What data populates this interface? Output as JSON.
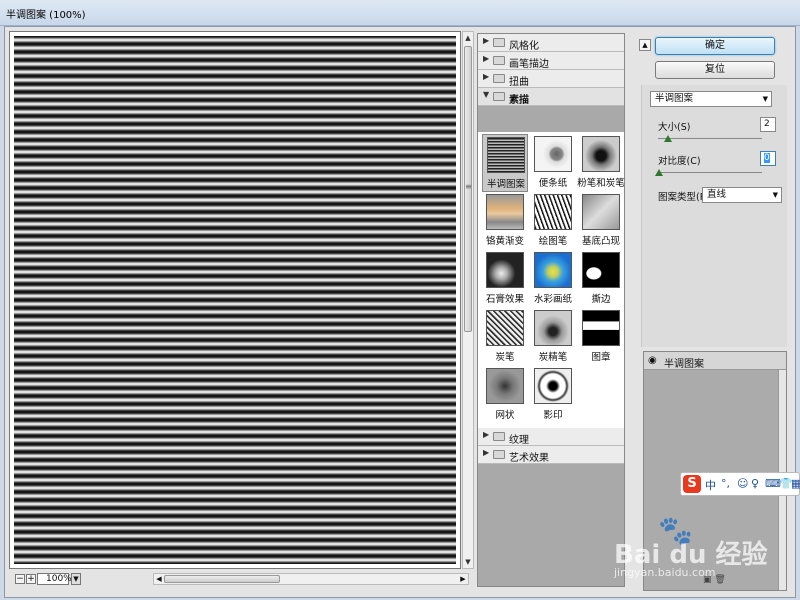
{
  "window": {
    "title": "半调图案 (100%)"
  },
  "preview": {
    "zoom": "100%"
  },
  "filter_gallery": {
    "categories": [
      {
        "label": "风格化",
        "expanded": false
      },
      {
        "label": "画笔描边",
        "expanded": false
      },
      {
        "label": "扭曲",
        "expanded": false
      },
      {
        "label": "素描",
        "expanded": true
      },
      {
        "label": "纹理",
        "expanded": false
      },
      {
        "label": "艺术效果",
        "expanded": false
      }
    ],
    "sketch_filters": [
      {
        "label": "半调图案",
        "selected": true
      },
      {
        "label": "便条纸",
        "selected": false
      },
      {
        "label": "粉笔和炭笔",
        "selected": false
      },
      {
        "label": "铬黄渐变",
        "selected": false
      },
      {
        "label": "绘图笔",
        "selected": false
      },
      {
        "label": "基底凸现",
        "selected": false
      },
      {
        "label": "石膏效果",
        "selected": false
      },
      {
        "label": "水彩画纸",
        "selected": false
      },
      {
        "label": "撕边",
        "selected": false
      },
      {
        "label": "炭笔",
        "selected": false
      },
      {
        "label": "炭精笔",
        "selected": false
      },
      {
        "label": "图章",
        "selected": false
      },
      {
        "label": "网状",
        "selected": false
      },
      {
        "label": "影印",
        "selected": false
      }
    ]
  },
  "actions": {
    "ok_label": "确定",
    "reset_label": "复位"
  },
  "settings": {
    "filter_select": "半调图案",
    "size_label": "大小(S)",
    "size_value": "2",
    "contrast_label": "对比度(C)",
    "contrast_value": "0",
    "pattern_type_label": "图案类型(P):",
    "pattern_type_value": "直线"
  },
  "layers": {
    "items": [
      {
        "label": "半调图案"
      }
    ]
  },
  "overlay": {
    "ime_letter": "S",
    "ime_text": "中",
    "watermark_logo": "Bai du 经验",
    "watermark_url": "jingyan.baidu.com"
  },
  "colors": {
    "accent": "#3c7fb1",
    "slider_knob": "#2a7a2a",
    "ime_red": "#e8391e"
  }
}
